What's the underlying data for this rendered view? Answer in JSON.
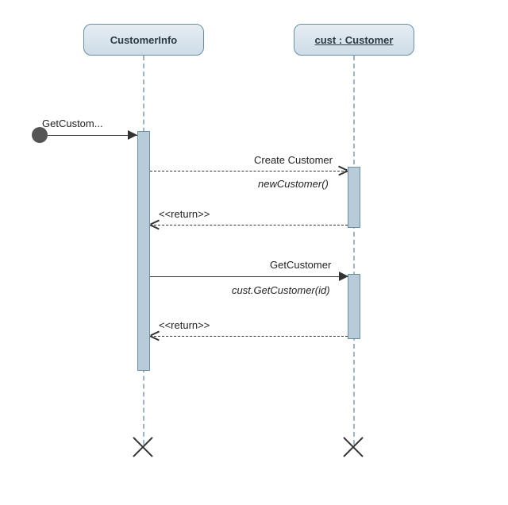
{
  "participants": {
    "p1": "CustomerInfo",
    "p2": "cust : Customer"
  },
  "messages": {
    "found": "GetCustom...",
    "create_top": "Create Customer",
    "create_sub": "newCustomer()",
    "return1": "<<return>>",
    "get_top": "GetCustomer",
    "get_sub": "cust.GetCustomer(id)",
    "return2": "<<return>>"
  },
  "diagram": {
    "type": "UML Sequence Diagram"
  }
}
